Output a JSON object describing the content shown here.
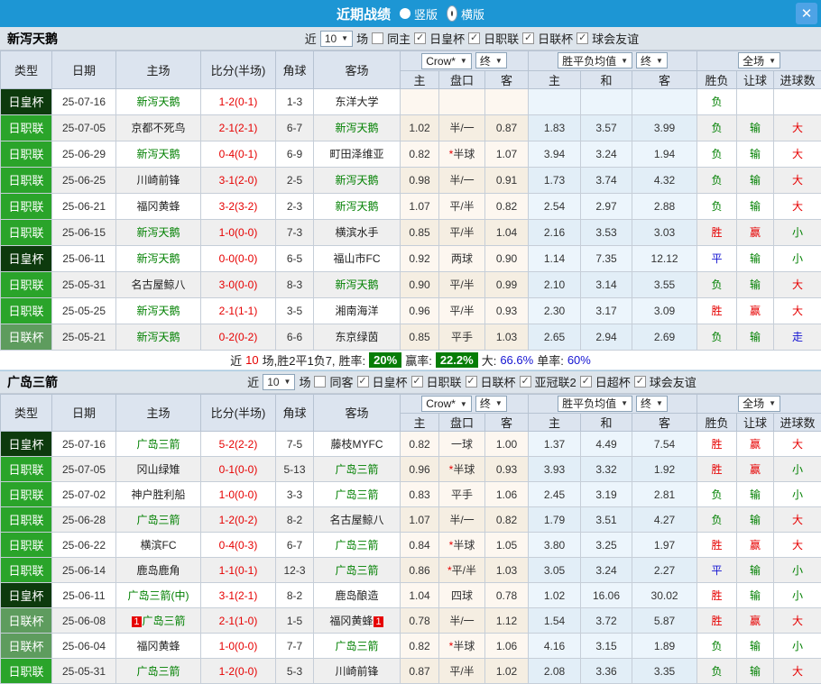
{
  "titlebar": {
    "title": "近期战绩",
    "options": [
      {
        "label": "竖版",
        "selected": false
      },
      {
        "label": "横版",
        "selected": true
      }
    ],
    "close_icon": "✕"
  },
  "colors": {
    "accent_blue": "#1d96d4",
    "team_green": "#008000",
    "result_red": "#e60000",
    "result_blue": "#1414d2",
    "cup_dark_green": "#0d3a0d",
    "league_green": "#2aa42a",
    "league_cup_green": "#5e9c5e",
    "rate_badge_green": "#067d06"
  },
  "table": {
    "left_columns": [
      "类型",
      "日期",
      "主场",
      "比分(半场)",
      "角球",
      "客场"
    ],
    "selects": {
      "bookmaker": "Crow*",
      "final1": "终",
      "average": "胜平负均值",
      "final2": "终",
      "fullmatch": "全场"
    },
    "sub_columns": [
      "主",
      "盘口",
      "客",
      "主",
      "和",
      "客",
      "胜负",
      "让球",
      "进球数"
    ]
  },
  "sections": [
    {
      "team": "新泻天鹅",
      "filter": {
        "near_label": "近",
        "count": "10",
        "matches_label": "场",
        "same_label": "同主",
        "same_checked": false,
        "leagues": [
          {
            "label": "日皇杯",
            "checked": true
          },
          {
            "label": "日职联",
            "checked": true
          },
          {
            "label": "日联杯",
            "checked": true
          },
          {
            "label": "球会友谊",
            "checked": true
          }
        ]
      },
      "rows": [
        {
          "type": "日皇杯",
          "tk": "cup",
          "date": "25-07-16",
          "home": "新泻天鹅",
          "hs": true,
          "hb": "",
          "score": "1-2",
          "half": "(0-1)",
          "corner": "1-3",
          "away": "东洋大学",
          "as": false,
          "ab": "",
          "o1": "",
          "hcap": "",
          "o3": "",
          "a1": "",
          "a2": "",
          "a3": "",
          "r1": [
            "负",
            "g"
          ],
          "r2": [
            "",
            ""
          ],
          "r3": [
            "",
            ""
          ]
        },
        {
          "type": "日职联",
          "tk": "lg",
          "date": "25-07-05",
          "home": "京都不死鸟",
          "hs": false,
          "hb": "",
          "score": "2-1",
          "half": "(2-1)",
          "corner": "6-7",
          "away": "新泻天鹅",
          "as": true,
          "ab": "",
          "o1": "1.02",
          "hcap": "半/一",
          "o3": "0.87",
          "a1": "1.83",
          "a2": "3.57",
          "a3": "3.99",
          "r1": [
            "负",
            "g"
          ],
          "r2": [
            "输",
            "g"
          ],
          "r3": [
            "大",
            "r"
          ]
        },
        {
          "type": "日职联",
          "tk": "lg",
          "date": "25-06-29",
          "home": "新泻天鹅",
          "hs": true,
          "hb": "",
          "score": "0-4",
          "half": "(0-1)",
          "corner": "6-9",
          "away": "町田泽维亚",
          "as": false,
          "ab": "",
          "o1": "0.82",
          "hcap": "*半球",
          "o3": "1.07",
          "a1": "3.94",
          "a2": "3.24",
          "a3": "1.94",
          "r1": [
            "负",
            "g"
          ],
          "r2": [
            "输",
            "g"
          ],
          "r3": [
            "大",
            "r"
          ]
        },
        {
          "type": "日职联",
          "tk": "lg",
          "date": "25-06-25",
          "home": "川崎前锋",
          "hs": false,
          "hb": "",
          "score": "3-1",
          "half": "(2-0)",
          "corner": "2-5",
          "away": "新泻天鹅",
          "as": true,
          "ab": "",
          "o1": "0.98",
          "hcap": "半/一",
          "o3": "0.91",
          "a1": "1.73",
          "a2": "3.74",
          "a3": "4.32",
          "r1": [
            "负",
            "g"
          ],
          "r2": [
            "输",
            "g"
          ],
          "r3": [
            "大",
            "r"
          ]
        },
        {
          "type": "日职联",
          "tk": "lg",
          "date": "25-06-21",
          "home": "福冈黄蜂",
          "hs": false,
          "hb": "",
          "score": "3-2",
          "half": "(3-2)",
          "corner": "2-3",
          "away": "新泻天鹅",
          "as": true,
          "ab": "",
          "o1": "1.07",
          "hcap": "平/半",
          "o3": "0.82",
          "a1": "2.54",
          "a2": "2.97",
          "a3": "2.88",
          "r1": [
            "负",
            "g"
          ],
          "r2": [
            "输",
            "g"
          ],
          "r3": [
            "大",
            "r"
          ]
        },
        {
          "type": "日职联",
          "tk": "lg",
          "date": "25-06-15",
          "home": "新泻天鹅",
          "hs": true,
          "hb": "",
          "score": "1-0",
          "half": "(0-0)",
          "corner": "7-3",
          "away": "横滨水手",
          "as": false,
          "ab": "",
          "o1": "0.85",
          "hcap": "平/半",
          "o3": "1.04",
          "a1": "2.16",
          "a2": "3.53",
          "a3": "3.03",
          "r1": [
            "胜",
            "r"
          ],
          "r2": [
            "赢",
            "r"
          ],
          "r3": [
            "小",
            "g"
          ]
        },
        {
          "type": "日皇杯",
          "tk": "cup",
          "date": "25-06-11",
          "home": "新泻天鹅",
          "hs": true,
          "hb": "",
          "score": "0-0",
          "half": "(0-0)",
          "corner": "6-5",
          "away": "福山市FC",
          "as": false,
          "ab": "",
          "o1": "0.92",
          "hcap": "两球",
          "o3": "0.90",
          "a1": "1.14",
          "a2": "7.35",
          "a3": "12.12",
          "r1": [
            "平",
            "b"
          ],
          "r2": [
            "输",
            "g"
          ],
          "r3": [
            "小",
            "g"
          ]
        },
        {
          "type": "日职联",
          "tk": "lg",
          "date": "25-05-31",
          "home": "名古屋鲸八",
          "hs": false,
          "hb": "",
          "score": "3-0",
          "half": "(0-0)",
          "corner": "8-3",
          "away": "新泻天鹅",
          "as": true,
          "ab": "",
          "o1": "0.90",
          "hcap": "平/半",
          "o3": "0.99",
          "a1": "2.10",
          "a2": "3.14",
          "a3": "3.55",
          "r1": [
            "负",
            "g"
          ],
          "r2": [
            "输",
            "g"
          ],
          "r3": [
            "大",
            "r"
          ]
        },
        {
          "type": "日职联",
          "tk": "lg",
          "date": "25-05-25",
          "home": "新泻天鹅",
          "hs": true,
          "hb": "",
          "score": "2-1",
          "half": "(1-1)",
          "corner": "3-5",
          "away": "湘南海洋",
          "as": false,
          "ab": "",
          "o1": "0.96",
          "hcap": "平/半",
          "o3": "0.93",
          "a1": "2.30",
          "a2": "3.17",
          "a3": "3.09",
          "r1": [
            "胜",
            "r"
          ],
          "r2": [
            "赢",
            "r"
          ],
          "r3": [
            "大",
            "r"
          ]
        },
        {
          "type": "日联杯",
          "tk": "lcup",
          "date": "25-05-21",
          "home": "新泻天鹅",
          "hs": true,
          "hb": "",
          "score": "0-2",
          "half": "(0-2)",
          "corner": "6-6",
          "away": "东京绿茵",
          "as": false,
          "ab": "",
          "o1": "0.85",
          "hcap": "平手",
          "o3": "1.03",
          "a1": "2.65",
          "a2": "2.94",
          "a3": "2.69",
          "r1": [
            "负",
            "g"
          ],
          "r2": [
            "输",
            "g"
          ],
          "r3": [
            "走",
            "b"
          ]
        }
      ],
      "summary": {
        "near": "近",
        "count": "10",
        "text": "场,胜2平1负7,",
        "win_label": "胜率:",
        "win": "20%",
        "profit_label": "赢率:",
        "profit": "22.2%",
        "big_label": "大:",
        "big": "66.6%",
        "single_label": "单率:",
        "single": "60%"
      }
    },
    {
      "team": "广岛三箭",
      "filter": {
        "near_label": "近",
        "count": "10",
        "matches_label": "场",
        "same_label": "同客",
        "same_checked": false,
        "leagues": [
          {
            "label": "日皇杯",
            "checked": true
          },
          {
            "label": "日职联",
            "checked": true
          },
          {
            "label": "日联杯",
            "checked": true
          },
          {
            "label": "亚冠联2",
            "checked": true
          },
          {
            "label": "日超杯",
            "checked": true
          },
          {
            "label": "球会友谊",
            "checked": true
          }
        ]
      },
      "rows": [
        {
          "type": "日皇杯",
          "tk": "cup",
          "date": "25-07-16",
          "home": "广岛三箭",
          "hs": true,
          "hb": "",
          "score": "5-2",
          "half": "(2-2)",
          "corner": "7-5",
          "away": "藤枝MYFC",
          "as": false,
          "ab": "",
          "o1": "0.82",
          "hcap": "一球",
          "o3": "1.00",
          "a1": "1.37",
          "a2": "4.49",
          "a3": "7.54",
          "r1": [
            "胜",
            "r"
          ],
          "r2": [
            "赢",
            "r"
          ],
          "r3": [
            "大",
            "r"
          ]
        },
        {
          "type": "日职联",
          "tk": "lg",
          "date": "25-07-05",
          "home": "冈山绿雉",
          "hs": false,
          "hb": "",
          "score": "0-1",
          "half": "(0-0)",
          "corner": "5-13",
          "away": "广岛三箭",
          "as": true,
          "ab": "",
          "o1": "0.96",
          "hcap": "*半球",
          "o3": "0.93",
          "a1": "3.93",
          "a2": "3.32",
          "a3": "1.92",
          "r1": [
            "胜",
            "r"
          ],
          "r2": [
            "赢",
            "r"
          ],
          "r3": [
            "小",
            "g"
          ]
        },
        {
          "type": "日职联",
          "tk": "lg",
          "date": "25-07-02",
          "home": "神户胜利船",
          "hs": false,
          "hb": "",
          "score": "1-0",
          "half": "(0-0)",
          "corner": "3-3",
          "away": "广岛三箭",
          "as": true,
          "ab": "",
          "o1": "0.83",
          "hcap": "平手",
          "o3": "1.06",
          "a1": "2.45",
          "a2": "3.19",
          "a3": "2.81",
          "r1": [
            "负",
            "g"
          ],
          "r2": [
            "输",
            "g"
          ],
          "r3": [
            "小",
            "g"
          ]
        },
        {
          "type": "日职联",
          "tk": "lg",
          "date": "25-06-28",
          "home": "广岛三箭",
          "hs": true,
          "hb": "",
          "score": "1-2",
          "half": "(0-2)",
          "corner": "8-2",
          "away": "名古屋鲸八",
          "as": false,
          "ab": "",
          "o1": "1.07",
          "hcap": "半/一",
          "o3": "0.82",
          "a1": "1.79",
          "a2": "3.51",
          "a3": "4.27",
          "r1": [
            "负",
            "g"
          ],
          "r2": [
            "输",
            "g"
          ],
          "r3": [
            "大",
            "r"
          ]
        },
        {
          "type": "日职联",
          "tk": "lg",
          "date": "25-06-22",
          "home": "横滨FC",
          "hs": false,
          "hb": "",
          "score": "0-4",
          "half": "(0-3)",
          "corner": "6-7",
          "away": "广岛三箭",
          "as": true,
          "ab": "",
          "o1": "0.84",
          "hcap": "*半球",
          "o3": "1.05",
          "a1": "3.80",
          "a2": "3.25",
          "a3": "1.97",
          "r1": [
            "胜",
            "r"
          ],
          "r2": [
            "赢",
            "r"
          ],
          "r3": [
            "大",
            "r"
          ]
        },
        {
          "type": "日职联",
          "tk": "lg",
          "date": "25-06-14",
          "home": "鹿岛鹿角",
          "hs": false,
          "hb": "",
          "score": "1-1",
          "half": "(0-1)",
          "corner": "12-3",
          "away": "广岛三箭",
          "as": true,
          "ab": "",
          "o1": "0.86",
          "hcap": "*平/半",
          "o3": "1.03",
          "a1": "3.05",
          "a2": "3.24",
          "a3": "2.27",
          "r1": [
            "平",
            "b"
          ],
          "r2": [
            "输",
            "g"
          ],
          "r3": [
            "小",
            "g"
          ]
        },
        {
          "type": "日皇杯",
          "tk": "cup",
          "date": "25-06-11",
          "home": "广岛三箭(中)",
          "hs": true,
          "hb": "",
          "score": "3-1",
          "half": "(2-1)",
          "corner": "8-2",
          "away": "鹿岛酿造",
          "as": false,
          "ab": "",
          "o1": "1.04",
          "hcap": "四球",
          "o3": "0.78",
          "a1": "1.02",
          "a2": "16.06",
          "a3": "30.02",
          "r1": [
            "胜",
            "r"
          ],
          "r2": [
            "输",
            "g"
          ],
          "r3": [
            "小",
            "g"
          ]
        },
        {
          "type": "日联杯",
          "tk": "lcup",
          "date": "25-06-08",
          "home": "广岛三箭",
          "hs": true,
          "hb": "1",
          "score": "2-1",
          "half": "(1-0)",
          "corner": "1-5",
          "away": "福冈黄蜂",
          "as": false,
          "ab": "1",
          "o1": "0.78",
          "hcap": "半/一",
          "o3": "1.12",
          "a1": "1.54",
          "a2": "3.72",
          "a3": "5.87",
          "r1": [
            "胜",
            "r"
          ],
          "r2": [
            "赢",
            "r"
          ],
          "r3": [
            "大",
            "r"
          ]
        },
        {
          "type": "日联杯",
          "tk": "lcup",
          "date": "25-06-04",
          "home": "福冈黄蜂",
          "hs": false,
          "hb": "",
          "score": "1-0",
          "half": "(0-0)",
          "corner": "7-7",
          "away": "广岛三箭",
          "as": true,
          "ab": "",
          "o1": "0.82",
          "hcap": "*半球",
          "o3": "1.06",
          "a1": "4.16",
          "a2": "3.15",
          "a3": "1.89",
          "r1": [
            "负",
            "g"
          ],
          "r2": [
            "输",
            "g"
          ],
          "r3": [
            "小",
            "g"
          ]
        },
        {
          "type": "日职联",
          "tk": "lg",
          "date": "25-05-31",
          "home": "广岛三箭",
          "hs": true,
          "hb": "",
          "score": "1-2",
          "half": "(0-0)",
          "corner": "5-3",
          "away": "川崎前锋",
          "as": false,
          "ab": "",
          "o1": "0.87",
          "hcap": "平/半",
          "o3": "1.02",
          "a1": "2.08",
          "a2": "3.36",
          "a3": "3.35",
          "r1": [
            "负",
            "g"
          ],
          "r2": [
            "输",
            "g"
          ],
          "r3": [
            "大",
            "r"
          ]
        }
      ],
      "summary": null
    }
  ]
}
